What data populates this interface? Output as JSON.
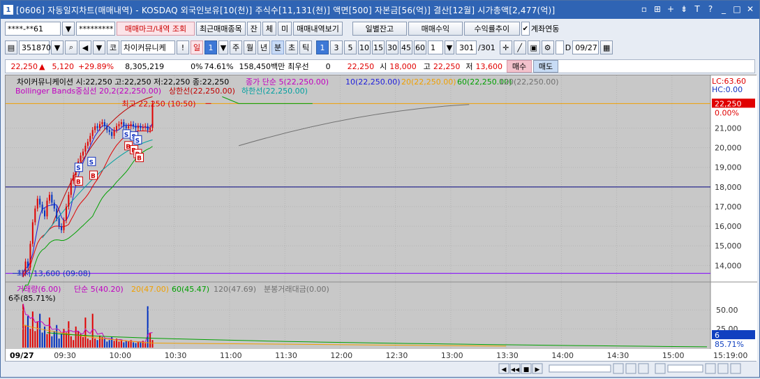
{
  "window": {
    "app_number": "1",
    "title": "[0606] 자동일지차트(매매내역) - KOSDAQ 외국인보유[10(천)] 주식수[11,131(천)] 액면[500] 자본금[56(억)] 결산[12월] 시가총액[2,477(억)]",
    "title_icons": [
      "window-icon",
      "grid-icon",
      "plus-icon",
      "pin-icon",
      "T",
      "?",
      "minimize-icon",
      "maximize-icon",
      "close-icon"
    ]
  },
  "toolbar1": {
    "account": "****-**61",
    "password": "*********",
    "trade_mark_btn": "매매마크/내역 조회",
    "recent_btn": "최근매매종목",
    "jan_btn": "잔",
    "che_btn": "체",
    "mi_btn": "미",
    "history_btn": "매매내역보기",
    "daily_balance_btn": "일별잔고",
    "trade_profit_btn": "매매수익",
    "profit_trend_btn": "수익률추이",
    "account_link_label": "계좌연동"
  },
  "toolbar2": {
    "code": "351870",
    "ko_label": "코",
    "stock_name": "차이커뮤니케",
    "period_selected": "일",
    "period_value": "1",
    "periods": [
      "주",
      "월",
      "년"
    ],
    "minute": "분",
    "second": "초",
    "tick": "틱",
    "intervals": [
      "1",
      "3",
      "5",
      "10",
      "15",
      "30",
      "45",
      "60"
    ],
    "interval_selected": "1",
    "count": "1",
    "range": "301",
    "range_total": "/301",
    "d_label": "D",
    "date": "09/27"
  },
  "quote": {
    "price": "22,250",
    "change": "5,120",
    "change_pct": "+29.89%",
    "volume": "8,305,219",
    "turnover_pct": "0%",
    "rate": "74.61%",
    "amount": "158,450백만",
    "priority_label": "최우선",
    "priority_value": "0",
    "ask": "22,250",
    "open_label": "시",
    "open": "18,000",
    "high_label": "고",
    "high": "22,250",
    "low_label": "저",
    "low": "13,600",
    "buy_btn": "매수",
    "sell_btn": "매도"
  },
  "colors": {
    "up": "#e00000",
    "down": "#0030c0",
    "ma5": "#1c1cdc",
    "ma20": "#f0a000",
    "ma60": "#00a000",
    "ma120": "#707070",
    "boll": "#c000c0"
  },
  "chart_data": [
    {
      "type": "candlestick",
      "legend_line1": [
        "차이커뮤니케이션 시:22,250 고:22,250 저:22,250 종:22,250",
        "종가 단순 5(22,250.00)",
        "10(22,250.00)",
        "20(22,250.00)",
        "60(22,250.00)",
        "120(22,250.00)"
      ],
      "legend_line2": [
        "Bollinger Bands중심선 20,2(22,250.00)",
        "상한선(22,250.00)",
        "하한선(22,250.00)"
      ],
      "high_annotation": "최고 22,250 (10:50)",
      "low_annotation": "최저 13,600 (09:08)",
      "lc_label": "LC:63.60",
      "hc_label": "HC:0.00",
      "current_price_label": "22,250",
      "current_pct_label": "0.00%",
      "y_ticks": [
        "21,000",
        "20,000",
        "19,000",
        "18,000",
        "17,000",
        "16,000",
        "15,000",
        "14,000"
      ],
      "ylim": [
        13300,
        23400
      ],
      "reference_lines": [
        18000,
        13600,
        22250
      ],
      "x_ticks": [
        "09/27",
        "09:30",
        "10:00",
        "10:30",
        "11:00",
        "11:30",
        "12:00",
        "12:30",
        "13:00",
        "13:30",
        "14:00",
        "14:30",
        "15:00",
        "15:19:00"
      ],
      "markers": [
        {
          "type": "S",
          "time": "09:38",
          "price": 19000
        },
        {
          "type": "B",
          "time": "09:38",
          "price": 18300
        },
        {
          "type": "S",
          "time": "09:45",
          "price": 19300
        },
        {
          "type": "B",
          "time": "09:46",
          "price": 18600
        },
        {
          "type": "S",
          "time": "10:04",
          "price": 20700
        },
        {
          "type": "B",
          "time": "10:05",
          "price": 20100
        },
        {
          "type": "S",
          "time": "10:08",
          "price": 20600
        },
        {
          "type": "B",
          "time": "10:08",
          "price": 19900
        },
        {
          "type": "S",
          "time": "10:10",
          "price": 20400
        },
        {
          "type": "B",
          "time": "10:10",
          "price": 19700
        },
        {
          "type": "B",
          "time": "10:11",
          "price": 19500
        }
      ],
      "close": [
        13600,
        14200,
        13900,
        15100,
        16200,
        16900,
        17400,
        17100,
        16800,
        16500,
        17300,
        17600,
        17200,
        16900,
        16400,
        16000,
        15800,
        16300,
        17000,
        17600,
        18300,
        18600,
        18900,
        19300,
        19600,
        19800,
        20100,
        20300,
        20600,
        20900,
        21100,
        21000,
        21200,
        21300,
        21100,
        20900,
        20800,
        20600,
        20900,
        21100,
        21200,
        21300,
        21100,
        21000,
        21100,
        21200,
        21100,
        21000,
        21100,
        21000,
        21050,
        21100,
        20900,
        21000,
        22250
      ]
    },
    {
      "type": "bar",
      "legend": [
        "거래량(6.00)",
        "단순 5(40.20)",
        "20(47.00)",
        "60(45.47)",
        "120(47.69)",
        "분봉거래대금(0.00)"
      ],
      "scale_label": "6주(85.71%)",
      "y_ticks": [
        "50.00",
        "25.00"
      ],
      "current_label": "6",
      "current_pct": "85.71%",
      "ylim": [
        0,
        65
      ],
      "values": [
        58,
        30,
        42,
        25,
        48,
        22,
        35,
        45,
        20,
        28,
        18,
        40,
        15,
        22,
        30,
        12,
        18,
        25,
        20,
        35,
        15,
        10,
        28,
        22,
        18,
        14,
        40,
        12,
        10,
        45,
        12,
        10,
        16,
        14,
        12,
        8,
        10,
        14,
        9,
        12,
        8,
        10,
        7,
        9,
        8,
        10,
        7,
        6,
        8,
        7,
        9,
        6,
        55,
        20,
        10
      ]
    }
  ],
  "playback": {
    "prev": "◀◀",
    "play": "▶",
    "next": "▶▶",
    "stop": "■"
  }
}
